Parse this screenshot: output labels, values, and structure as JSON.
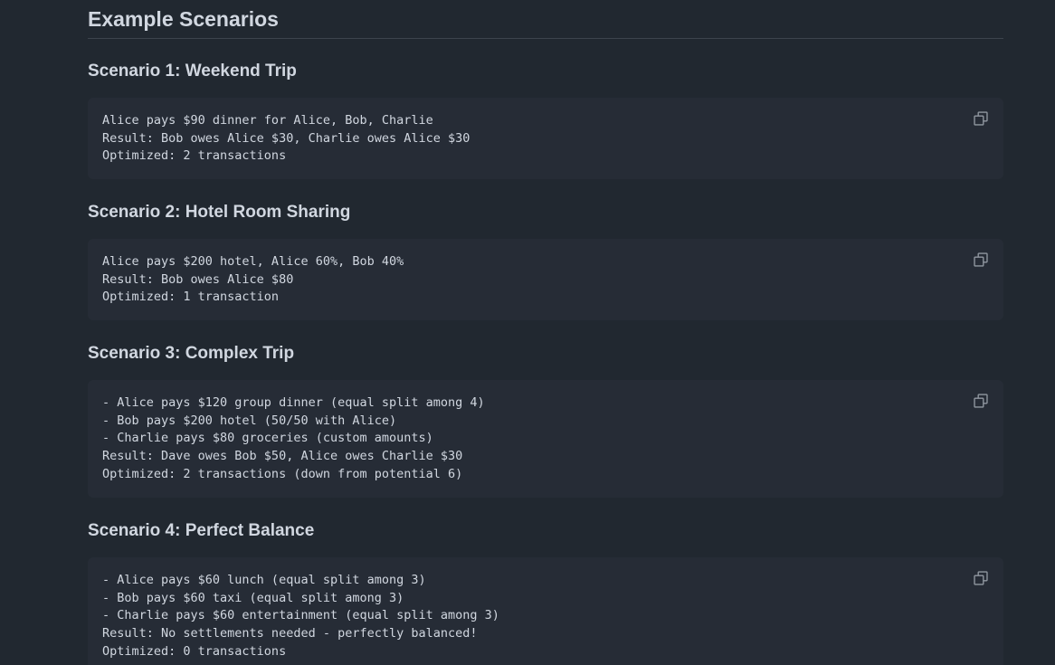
{
  "section": {
    "title": "Example Scenarios"
  },
  "scenarios": [
    {
      "title": "Scenario 1: Weekend Trip",
      "lines": [
        "Alice pays $90 dinner for Alice, Bob, Charlie",
        "Result: Bob owes Alice $30, Charlie owes Alice $30",
        "Optimized: 2 transactions"
      ]
    },
    {
      "title": "Scenario 2: Hotel Room Sharing",
      "lines": [
        "Alice pays $200 hotel, Alice 60%, Bob 40%",
        "Result: Bob owes Alice $80",
        "Optimized: 1 transaction"
      ]
    },
    {
      "title": "Scenario 3: Complex Trip",
      "lines": [
        "- Alice pays $120 group dinner (equal split among 4)",
        "- Bob pays $200 hotel (50/50 with Alice)",
        "- Charlie pays $80 groceries (custom amounts)",
        "Result: Dave owes Bob $50, Alice owes Charlie $30",
        "Optimized: 2 transactions (down from potential 6)"
      ]
    },
    {
      "title": "Scenario 4: Perfect Balance",
      "lines": [
        "- Alice pays $60 lunch (equal split among 3)",
        "- Bob pays $60 taxi (equal split among 3)",
        "- Charlie pays $60 entertainment (equal split among 3)",
        "Result: No settlements needed - perfectly balanced!",
        "Optimized: 0 transactions"
      ]
    }
  ],
  "icons": {
    "copy": "copy-icon"
  },
  "colors": {
    "background": "#212830",
    "code_background": "#262c36",
    "text": "#d1d7e0",
    "icon": "#9198a1",
    "divider": "#3d444d"
  }
}
